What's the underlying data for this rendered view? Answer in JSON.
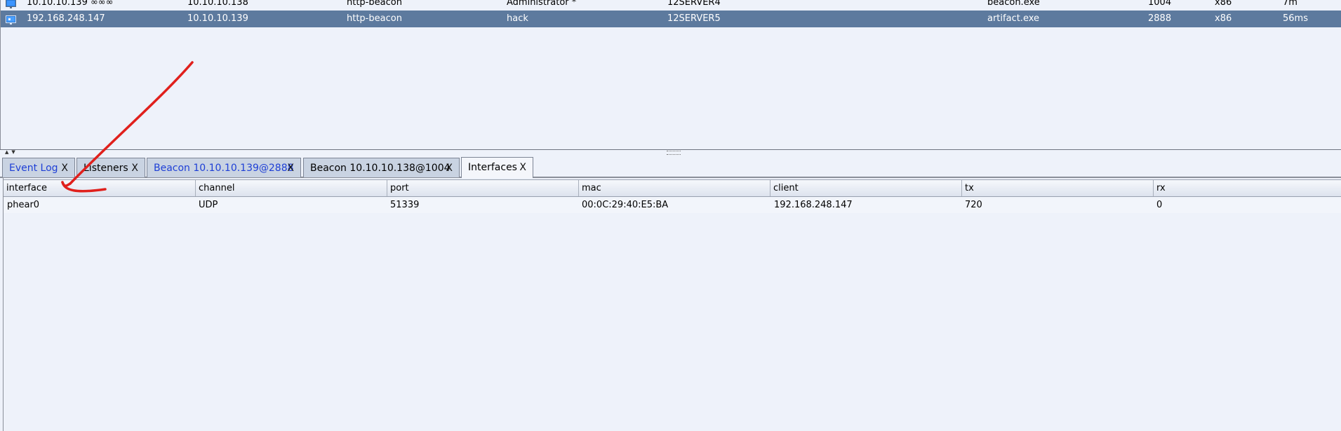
{
  "sessions": {
    "rows": [
      {
        "external": "10.10.10.139 ∞∞∞",
        "internal": "10.10.10.138",
        "listener": "http-beacon",
        "user": "Administrator *",
        "computer": "12SERVER4",
        "process": "beacon.exe",
        "pid": "1004",
        "arch": "x86",
        "last": "7m",
        "selected": false
      },
      {
        "external": "192.168.248.147",
        "internal": "10.10.10.139",
        "listener": "http-beacon",
        "user": "hack",
        "computer": "12SERVER5",
        "process": "artifact.exe",
        "pid": "2888",
        "arch": "x86",
        "last": "56ms",
        "selected": true
      }
    ]
  },
  "tabs": [
    {
      "label": "Event Log",
      "close": "X",
      "blue": true,
      "active": false
    },
    {
      "label": "Listeners",
      "close": "X",
      "blue": false,
      "active": false
    },
    {
      "label": "Beacon 10.10.10.139@2888",
      "close": "X",
      "blue": true,
      "active": false
    },
    {
      "label": "Beacon 10.10.10.138@1004",
      "close": "X",
      "blue": false,
      "active": false
    },
    {
      "label": "Interfaces",
      "close": "X",
      "blue": false,
      "active": true
    }
  ],
  "interfaces": {
    "columns": [
      "interface",
      "channel",
      "port",
      "mac",
      "client",
      "tx",
      "rx"
    ],
    "rows": [
      [
        "phear0",
        "UDP",
        "51339",
        "00:0C:29:40:E5:BA",
        "192.168.248.147",
        "720",
        "0"
      ]
    ]
  },
  "colors": {
    "selected_row": "#5d7a9e",
    "blue_tab_text": "#1e3fd6",
    "annotation": "#e0201c"
  },
  "icons": {
    "session": "windows-monitor-icon",
    "annotation": "red-arrow-annotation"
  }
}
